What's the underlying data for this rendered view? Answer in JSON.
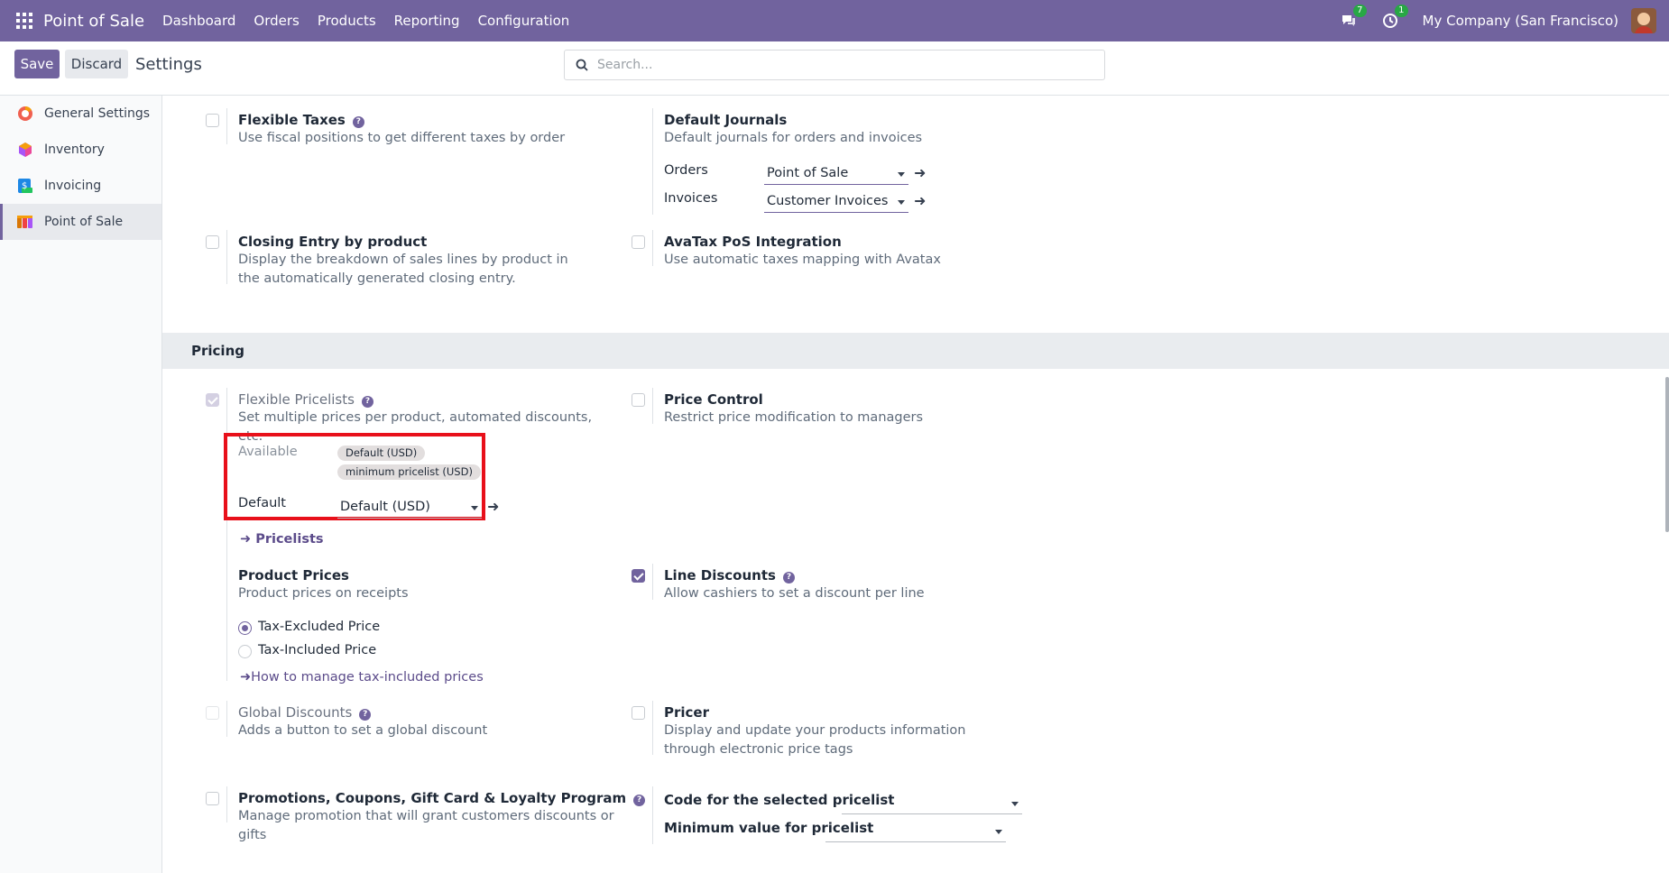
{
  "navbar": {
    "brand": "Point of Sale",
    "menu": [
      "Dashboard",
      "Orders",
      "Products",
      "Reporting",
      "Configuration"
    ],
    "messages_badge": "7",
    "activity_badge": "1",
    "company": "My Company (San Francisco)"
  },
  "control": {
    "save_label": "Save",
    "discard_label": "Discard",
    "title": "Settings",
    "search_placeholder": "Search..."
  },
  "sidebar": {
    "items": [
      {
        "label": "General Settings",
        "icon": "general-settings-icon",
        "color": "#f06050"
      },
      {
        "label": "Inventory",
        "icon": "inventory-icon",
        "color": "#a855f7"
      },
      {
        "label": "Invoicing",
        "icon": "invoicing-icon",
        "color": "#1e88e5"
      },
      {
        "label": "Point of Sale",
        "icon": "point-of-sale-icon",
        "color": "#d97706",
        "active": true
      }
    ]
  },
  "settings": {
    "flexible_taxes": {
      "title": "Flexible Taxes",
      "desc": "Use fiscal positions to get different taxes by order",
      "checked": false
    },
    "default_journals": {
      "title": "Default Journals",
      "desc": "Default journals for orders and invoices",
      "orders_label": "Orders",
      "orders_value": "Point of Sale",
      "invoices_label": "Invoices",
      "invoices_value": "Customer Invoices"
    },
    "closing_entry": {
      "title": "Closing Entry by product",
      "desc": "Display the breakdown of sales lines by product in the automatically generated closing entry.",
      "checked": false
    },
    "avatax": {
      "title": "AvaTax PoS Integration",
      "desc": "Use automatic taxes mapping with Avatax",
      "checked": false
    }
  },
  "pricing": {
    "section_title": "Pricing",
    "flexible_pricelists": {
      "title": "Flexible Pricelists",
      "desc": "Set multiple prices per product, automated discounts, etc.",
      "checked": true,
      "available_label": "Available",
      "available_tags": [
        "Default (USD)",
        "minimum pricelist (USD)"
      ],
      "default_label": "Default",
      "default_value": "Default (USD)",
      "pricelists_link": "Pricelists"
    },
    "price_control": {
      "title": "Price Control",
      "desc": "Restrict price modification to managers",
      "checked": false
    },
    "product_prices": {
      "title": "Product Prices",
      "desc": "Product prices on receipts",
      "options": [
        "Tax-Excluded Price",
        "Tax-Included Price"
      ],
      "selected": "Tax-Excluded Price",
      "help_link": "How to manage tax-included prices"
    },
    "line_discounts": {
      "title": "Line Discounts",
      "desc": "Allow cashiers to set a discount per line",
      "checked": true
    },
    "global_discounts": {
      "title": "Global Discounts",
      "desc": "Adds a button to set a global discount",
      "checked": false
    },
    "pricer": {
      "title": "Pricer",
      "desc": "Display and update your products information through electronic price tags",
      "checked": false
    },
    "promotions": {
      "title": "Promotions, Coupons, Gift Card & Loyalty Program",
      "desc": "Manage promotion that will grant customers discounts or gifts",
      "checked": false
    },
    "code_pricelist": {
      "label": "Code for the selected pricelist",
      "value": ""
    },
    "min_value_pricelist": {
      "label": "Minimum value for pricelist",
      "value": ""
    }
  },
  "colors": {
    "brand": "#71639e",
    "highlight": "#e8101a",
    "badge": "#28a745"
  }
}
